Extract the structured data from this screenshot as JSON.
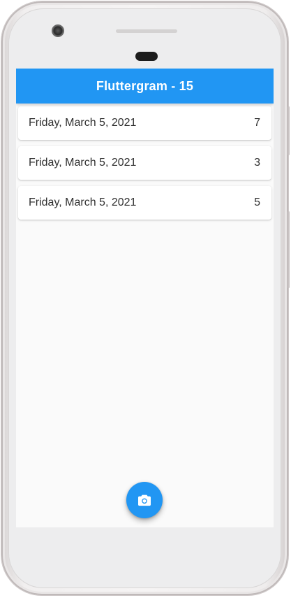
{
  "app_bar": {
    "title": "Fluttergram - 15",
    "color": "#2196f3"
  },
  "entries": [
    {
      "date": "Friday, March 5, 2021",
      "count": "7"
    },
    {
      "date": "Friday, March 5, 2021",
      "count": "3"
    },
    {
      "date": "Friday, March 5, 2021",
      "count": "5"
    }
  ],
  "fab": {
    "icon": "camera-icon",
    "color": "#2196f3"
  }
}
